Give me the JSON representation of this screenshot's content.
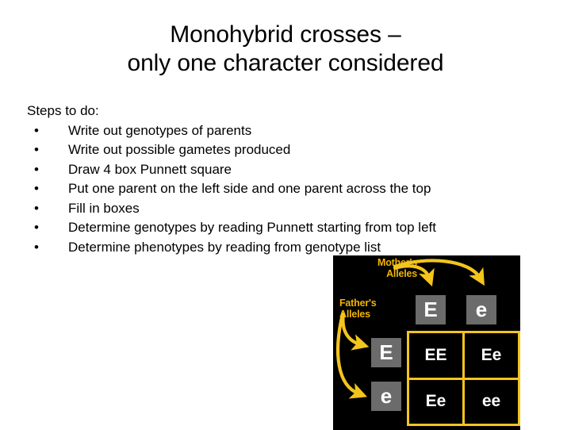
{
  "slide": {
    "title_line_1": "Monohybrid crosses –",
    "title_line_2": "only one character considered",
    "steps_heading": "Steps to do:",
    "bullet_glyph": "•",
    "steps": [
      "Write out genotypes of parents",
      "Write out possible gametes produced",
      "Draw 4 box Punnett square",
      "Put one parent on the left side and one parent across the top",
      "Fill in boxes",
      "Determine genotypes by reading Punnett starting from top left",
      "Determine phenotypes by reading from genotype list"
    ]
  },
  "punnett": {
    "mothers_label_line_1": "Mother's",
    "mothers_label_line_2": "Alleles",
    "fathers_label_line_1": "Father's",
    "fathers_label_line_2": "Alleles",
    "mother_alleles": [
      "E",
      "e"
    ],
    "father_alleles": [
      "E",
      "e"
    ],
    "grid": [
      [
        "EE",
        "Ee"
      ],
      [
        "Ee",
        "ee"
      ]
    ],
    "colors": {
      "background": "#000000",
      "label_gold": "#f0b400",
      "grid_border_gold": "#f3c51c",
      "tile_grey": "#6b6b6b",
      "text_white": "#ffffff"
    }
  }
}
